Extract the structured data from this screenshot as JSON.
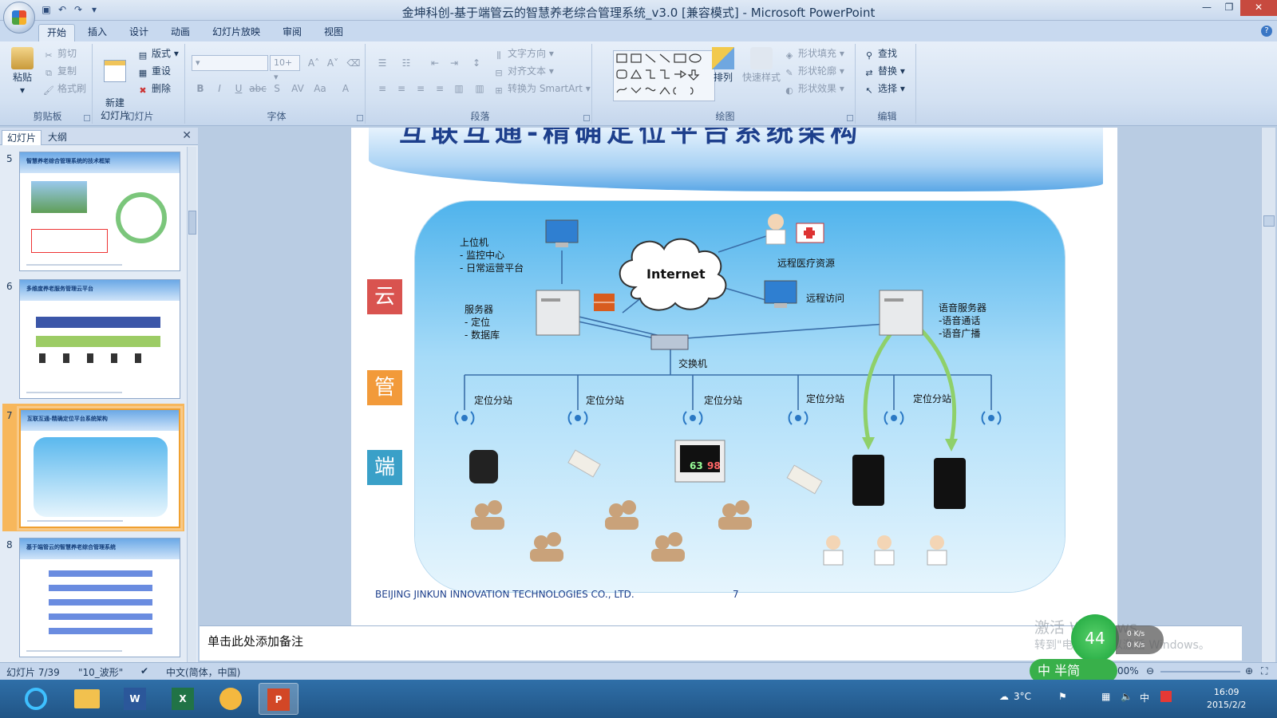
{
  "window": {
    "title": "金坤科创-基于端管云的智慧养老综合管理系统_v3.0 [兼容模式] - Microsoft PowerPoint"
  },
  "ribbon_tabs": [
    "开始",
    "插入",
    "设计",
    "动画",
    "幻灯片放映",
    "审阅",
    "视图"
  ],
  "ribbon": {
    "clipboard": {
      "label": "剪贴板",
      "paste": "粘贴",
      "cut": "剪切",
      "copy": "复制",
      "format_painter": "格式刷"
    },
    "slides": {
      "label": "幻灯片",
      "new_slide": "新建\n幻灯片",
      "layout": "版式",
      "reset": "重设",
      "delete": "删除"
    },
    "font": {
      "label": "字体",
      "size": "10+"
    },
    "paragraph": {
      "label": "段落",
      "text_direction": "文字方向",
      "align_text": "对齐文本",
      "smartart": "转换为 SmartArt"
    },
    "drawing": {
      "label": "绘图",
      "arrange": "排列",
      "quick_styles": "快速样式",
      "shape_fill": "形状填充",
      "shape_outline": "形状轮廓",
      "shape_effects": "形状效果"
    },
    "editing": {
      "label": "编辑",
      "find": "查找",
      "replace": "替换",
      "select": "选择"
    }
  },
  "pane": {
    "tabs": [
      "幻灯片",
      "大纲"
    ],
    "thumbnails": [
      {
        "num": "5",
        "title": "智慧养老综合管理系统的技术框架"
      },
      {
        "num": "6",
        "title": "多维度养老服务管理云平台"
      },
      {
        "num": "7",
        "title": "互联互通-精确定位平台系统架构"
      },
      {
        "num": "8",
        "title": "基于端管云的智慧养老综合管理系统"
      }
    ]
  },
  "slide": {
    "title": "互联互通-精确定位平台系统架构",
    "tiers": [
      "云",
      "管",
      "端"
    ],
    "host_label": "上位机",
    "host_items": [
      "- 监控中心",
      "- 日常运营平台"
    ],
    "internet": "Internet",
    "remote_medical": "远程医疗资源",
    "remote_access": "远程访问",
    "server_label": "服务器",
    "server_items": [
      "- 定位",
      "- 数据库"
    ],
    "voice_server_label": "语音服务器",
    "voice_items": [
      "-语音通话",
      "-语音广播"
    ],
    "switch": "交换机",
    "stations": [
      "定位分站",
      "定位分站",
      "定位分站",
      "定位分站",
      "定位分站"
    ],
    "monitor_readings": [
      "63",
      "98"
    ],
    "footer": "BEIJING JINKUN INNOVATION TECHNOLOGIES CO., LTD.",
    "page_number": "7"
  },
  "notes": {
    "placeholder": "单击此处添加备注"
  },
  "status": {
    "slide_counter": "幻灯片 7/39",
    "theme": "\"10_波形\"",
    "language": "中文(简体，中国)",
    "zoom": "00%"
  },
  "overlay": {
    "activate_title": "激活 Windows",
    "activate_sub": "转到\"电脑设置\"以激活 Windows。",
    "net_percent": "44",
    "net_up": "0 K/s",
    "net_down": "0 K/s",
    "ime": "中 半简"
  },
  "taskbar": {
    "temperature": "3°C",
    "tray_lang": "中",
    "time": "16:09",
    "date": "2015/2/2"
  },
  "colors": {
    "tier_cloud": "#d9534f",
    "tier_pipe": "#f29a3a",
    "tier_end": "#3aa0c8",
    "green_arrow": "#8fd06a",
    "line_blue": "#3a6ea8"
  }
}
